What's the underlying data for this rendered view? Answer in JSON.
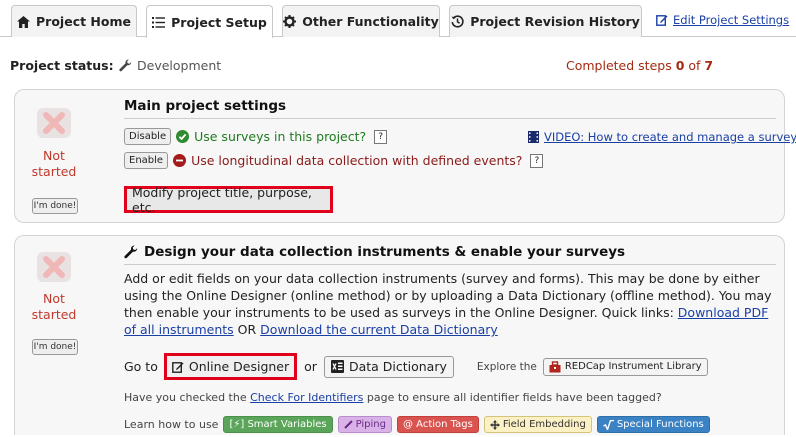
{
  "tabs": [
    {
      "label": "Project Home",
      "icon": "home-icon",
      "active": false
    },
    {
      "label": "Project Setup",
      "icon": "list-icon",
      "active": true
    },
    {
      "label": "Other Functionality",
      "icon": "gear-icon",
      "active": false
    },
    {
      "label": "Project Revision History",
      "icon": "history-icon",
      "active": false
    }
  ],
  "edit_settings_link": "Edit Project Settings",
  "status": {
    "label": "Project status:",
    "value": "Development",
    "completed_prefix": "Completed steps ",
    "completed_count": "0",
    "completed_suffix": " of ",
    "completed_total": "7"
  },
  "step1": {
    "state": "Not started",
    "done_label": "I'm done!",
    "title": "Main project settings",
    "surveys": {
      "button": "Disable",
      "text": "Use surveys in this project?",
      "help": "?",
      "enabled": true
    },
    "longitudinal": {
      "button": "Enable",
      "text": "Use longitudinal data collection with defined events?",
      "help": "?",
      "enabled": false
    },
    "video_link": "VIDEO: How to create and manage a survey",
    "modify_button": "Modify project title, purpose, etc."
  },
  "step2": {
    "state": "Not started",
    "done_label": "I'm done!",
    "title": "Design your data collection instruments & enable your surveys",
    "para_text": "Add or edit fields on your data collection instruments (survey and forms). This may be done by either using the Online Designer (online method) or by uploading a Data Dictionary (offline method). You may then enable your instruments to be used as surveys in the Online Designer. Quick links: ",
    "link_pdf": "Download PDF of all instruments",
    "or_text": " OR ",
    "link_dd": "Download the current Data Dictionary",
    "goto_label": "Go to",
    "online_designer": "Online Designer",
    "or_label": "or",
    "data_dictionary": "Data Dictionary",
    "explore_label": "Explore the",
    "library_button": "REDCap Instrument Library",
    "check_prefix": "Have you checked the ",
    "check_link": "Check For Identifiers",
    "check_suffix": " page to ensure all identifier fields have been tagged?",
    "learn_label": "Learn how to use",
    "tags": [
      {
        "label": "[⚡] Smart Variables",
        "bg": "#5aa55a",
        "fg": "#ffffff",
        "border": "#4a8f4a"
      },
      {
        "label": "Piping",
        "bg": "#d9b3e8",
        "fg": "#6a2a8a",
        "border": "#b98ccd"
      },
      {
        "label": "@ Action Tags",
        "bg": "#d9534f",
        "fg": "#ffffff",
        "border": "#c23f3b"
      },
      {
        "label": "Field Embedding",
        "bg": "#fcf1c4",
        "fg": "#333333",
        "border": "#d6c37a"
      },
      {
        "label": "Special Functions",
        "bg": "#3b82c4",
        "fg": "#ffffff",
        "border": "#2f6fa8"
      }
    ]
  },
  "colors": {
    "accent_red": "#e0001b",
    "link": "#1a3fa5",
    "not_started": "#c0392b"
  }
}
